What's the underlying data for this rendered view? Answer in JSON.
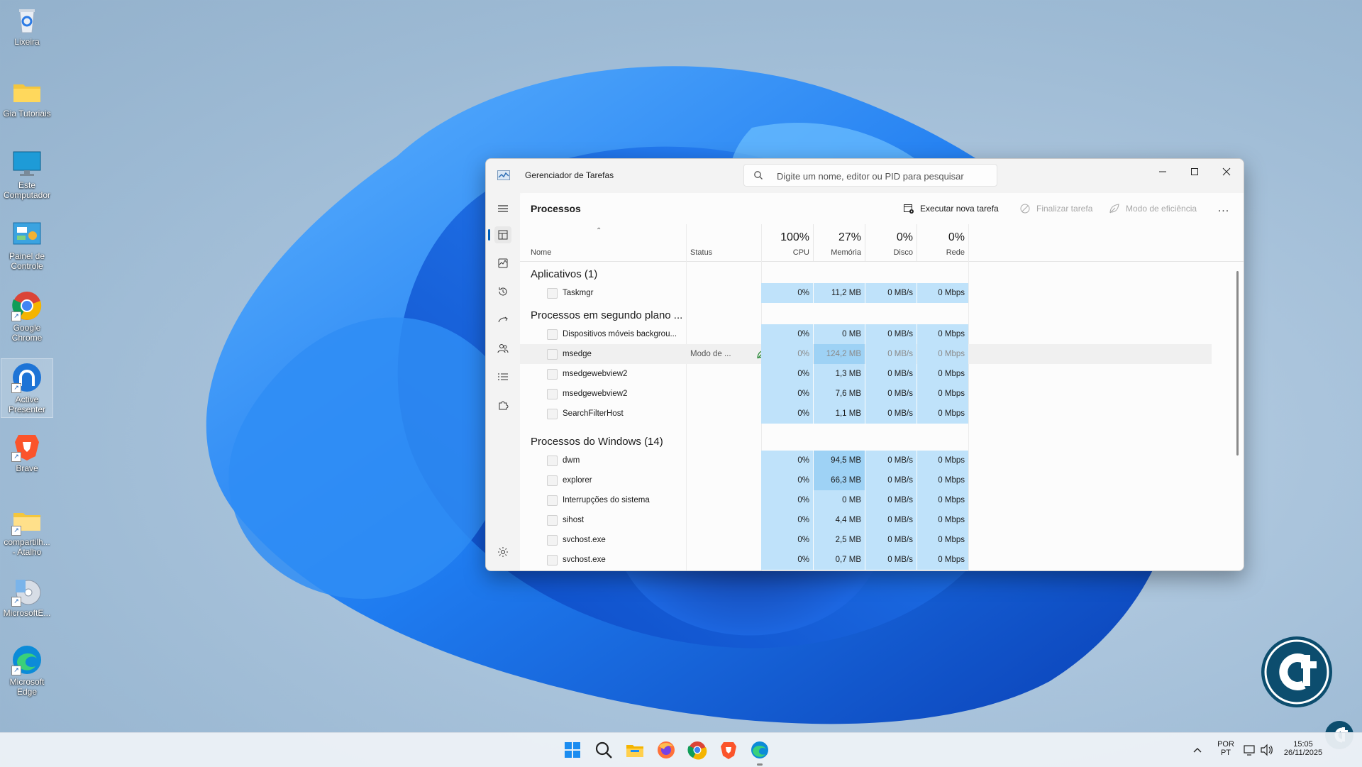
{
  "desktop": {
    "icons": [
      {
        "label": "Lixeira",
        "icon": "recycle-bin-icon"
      },
      {
        "label": "Gia Tutoriais",
        "icon": "folder-icon"
      },
      {
        "label": "Este Computador",
        "icon": "monitor-icon"
      },
      {
        "label": "Painel de Controle",
        "icon": "control-panel-icon"
      },
      {
        "label": "Google Chrome",
        "icon": "chrome-icon"
      },
      {
        "label": "Active Presenter",
        "icon": "active-presenter-icon"
      },
      {
        "label": "Brave",
        "icon": "brave-icon"
      },
      {
        "label": "compartilh... - Atalho",
        "icon": "shared-folder-icon"
      },
      {
        "label": "MicrosoftE...",
        "icon": "disc-installer-icon"
      },
      {
        "label": "Microsoft Edge",
        "icon": "edge-icon"
      }
    ]
  },
  "window": {
    "title": "Gerenciador de Tarefas",
    "search_placeholder": "Digite um nome, editor ou PID para pesquisar",
    "page_title": "Processos",
    "commands": {
      "run_new_task": "Executar nova tarefa",
      "end_task": "Finalizar tarefa",
      "efficiency_mode": "Modo de eficiência",
      "more": "..."
    },
    "columns": {
      "name": "Nome",
      "status": "Status",
      "cpu": {
        "pct": "100%",
        "label": "CPU"
      },
      "memory": {
        "pct": "27%",
        "label": "Memória"
      },
      "disk": {
        "pct": "0%",
        "label": "Disco"
      },
      "network": {
        "pct": "0%",
        "label": "Rede"
      }
    },
    "groups": [
      {
        "name": "Aplicativos (1)",
        "rows": [
          {
            "name": "Taskmgr",
            "status": "",
            "cpu": "0%",
            "mem": "11,2 MB",
            "disk": "0 MB/s",
            "net": "0 Mbps"
          }
        ]
      },
      {
        "name": "Processos em segundo plano ...",
        "rows": [
          {
            "name": "Dispositivos móveis backgrou...",
            "status": "",
            "cpu": "0%",
            "mem": "0 MB",
            "disk": "0 MB/s",
            "net": "0 Mbps"
          },
          {
            "name": "msedge",
            "status": "Modo de ...",
            "cpu": "0%",
            "mem": "124,2 MB",
            "disk": "0 MB/s",
            "net": "0 Mbps"
          },
          {
            "name": "msedgewebview2",
            "status": "",
            "cpu": "0%",
            "mem": "1,3 MB",
            "disk": "0 MB/s",
            "net": "0 Mbps"
          },
          {
            "name": "msedgewebview2",
            "status": "",
            "cpu": "0%",
            "mem": "7,6 MB",
            "disk": "0 MB/s",
            "net": "0 Mbps"
          },
          {
            "name": "SearchFilterHost",
            "status": "",
            "cpu": "0%",
            "mem": "1,1 MB",
            "disk": "0 MB/s",
            "net": "0 Mbps"
          }
        ]
      },
      {
        "name": "Processos do Windows (14)",
        "rows": [
          {
            "name": "dwm",
            "status": "",
            "cpu": "0%",
            "mem": "94,5 MB",
            "disk": "0 MB/s",
            "net": "0 Mbps"
          },
          {
            "name": "explorer",
            "status": "",
            "cpu": "0%",
            "mem": "66,3 MB",
            "disk": "0 MB/s",
            "net": "0 Mbps"
          },
          {
            "name": "Interrupções do sistema",
            "status": "",
            "cpu": "0%",
            "mem": "0 MB",
            "disk": "0 MB/s",
            "net": "0 Mbps"
          },
          {
            "name": "sihost",
            "status": "",
            "cpu": "0%",
            "mem": "4,4 MB",
            "disk": "0 MB/s",
            "net": "0 Mbps"
          },
          {
            "name": "svchost.exe",
            "status": "",
            "cpu": "0%",
            "mem": "2,5 MB",
            "disk": "0 MB/s",
            "net": "0 Mbps"
          },
          {
            "name": "svchost.exe",
            "status": "",
            "cpu": "0%",
            "mem": "0,7 MB",
            "disk": "0 MB/s",
            "net": "0 Mbps"
          }
        ]
      }
    ]
  },
  "taskbar": {
    "apps": [
      "windows-start-icon",
      "search-icon",
      "file-explorer-icon",
      "firefox-icon",
      "chrome-icon",
      "brave-icon",
      "edge-icon"
    ],
    "tray": {
      "lang_top": "POR",
      "lang_bottom": "PT",
      "time": "15:05",
      "date": "26/11/2025"
    }
  },
  "colors": {
    "accent": "#005fb8",
    "heat_light": "#bfe2fa",
    "heat_strong": "#9ed2f5"
  }
}
